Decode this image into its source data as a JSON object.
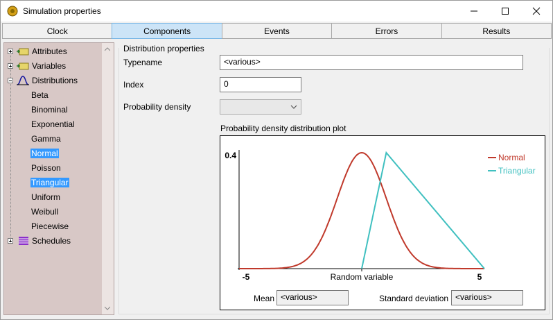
{
  "window": {
    "title": "Simulation properties"
  },
  "tabs": [
    {
      "label": "Clock",
      "active": false
    },
    {
      "label": "Components",
      "active": true
    },
    {
      "label": "Events",
      "active": false
    },
    {
      "label": "Errors",
      "active": false
    },
    {
      "label": "Results",
      "active": false
    }
  ],
  "tree": {
    "attributes": "Attributes",
    "variables": "Variables",
    "distributions": "Distributions",
    "children": [
      "Beta",
      "Binominal",
      "Exponential",
      "Gamma",
      "Normal",
      "Poisson",
      "Triangular",
      "Uniform",
      "Weibull",
      "Piecewise"
    ],
    "selected": [
      "Normal",
      "Triangular"
    ],
    "schedules": "Schedules"
  },
  "form": {
    "group_title": "Distribution properties",
    "typename_label": "Typename",
    "typename_value": "<various>",
    "index_label": "Index",
    "index_value": "0",
    "density_label": "Probability density",
    "density_value": ""
  },
  "plot": {
    "caption": "Probability density distribution plot",
    "mean_label": "Mean",
    "mean_value": "<various>",
    "sd_label": "Standard deviation",
    "sd_value": "<various>"
  },
  "chart_data": {
    "type": "line",
    "xlabel": "Random variable",
    "x_ticks": [
      "-5",
      "5"
    ],
    "y_ticks": [
      "0.4"
    ],
    "xlim": [
      -5,
      5
    ],
    "ylim": [
      0,
      0.4
    ],
    "legend_position": "top-right",
    "series": [
      {
        "name": "Normal",
        "color": "#c0392b",
        "kind": "normal",
        "mean": 0,
        "sd": 1
      },
      {
        "name": "Triangular",
        "color": "#40c0c0",
        "kind": "triangular",
        "points": [
          [
            0,
            0
          ],
          [
            1,
            0.4
          ],
          [
            5,
            0
          ]
        ]
      }
    ]
  }
}
